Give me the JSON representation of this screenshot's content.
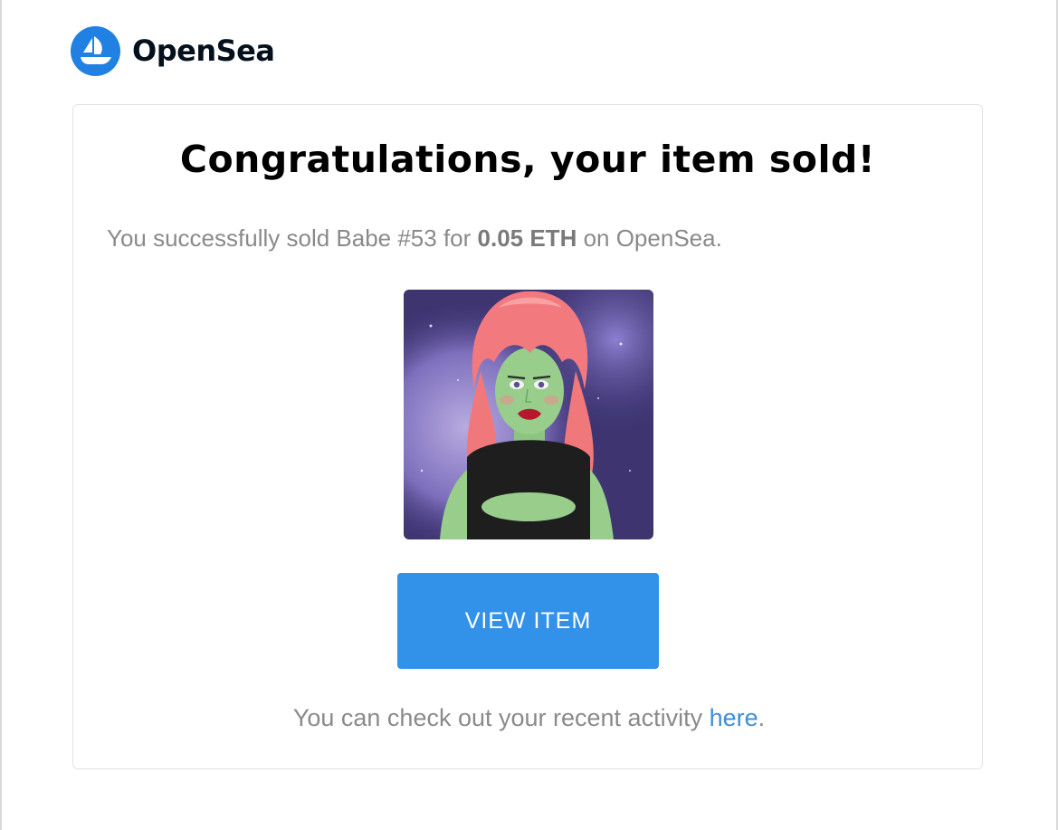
{
  "brand": {
    "name": "OpenSea",
    "logo_icon": "opensea-ship-icon",
    "accent_color": "#2081e2"
  },
  "email": {
    "title": "Congratulations, your item sold!",
    "summary": {
      "prefix": "You successfully sold Babe #53 for ",
      "price": "0.05 ETH",
      "suffix": " on OpenSea."
    },
    "nft_image": {
      "icon": "nft-babe-artwork",
      "description_name": "Babe #53"
    },
    "view_item_label": "VIEW ITEM",
    "button_color": "#3291e9",
    "footer": {
      "prefix": "You can check out your recent activity ",
      "link_text": "here",
      "suffix": "."
    }
  }
}
